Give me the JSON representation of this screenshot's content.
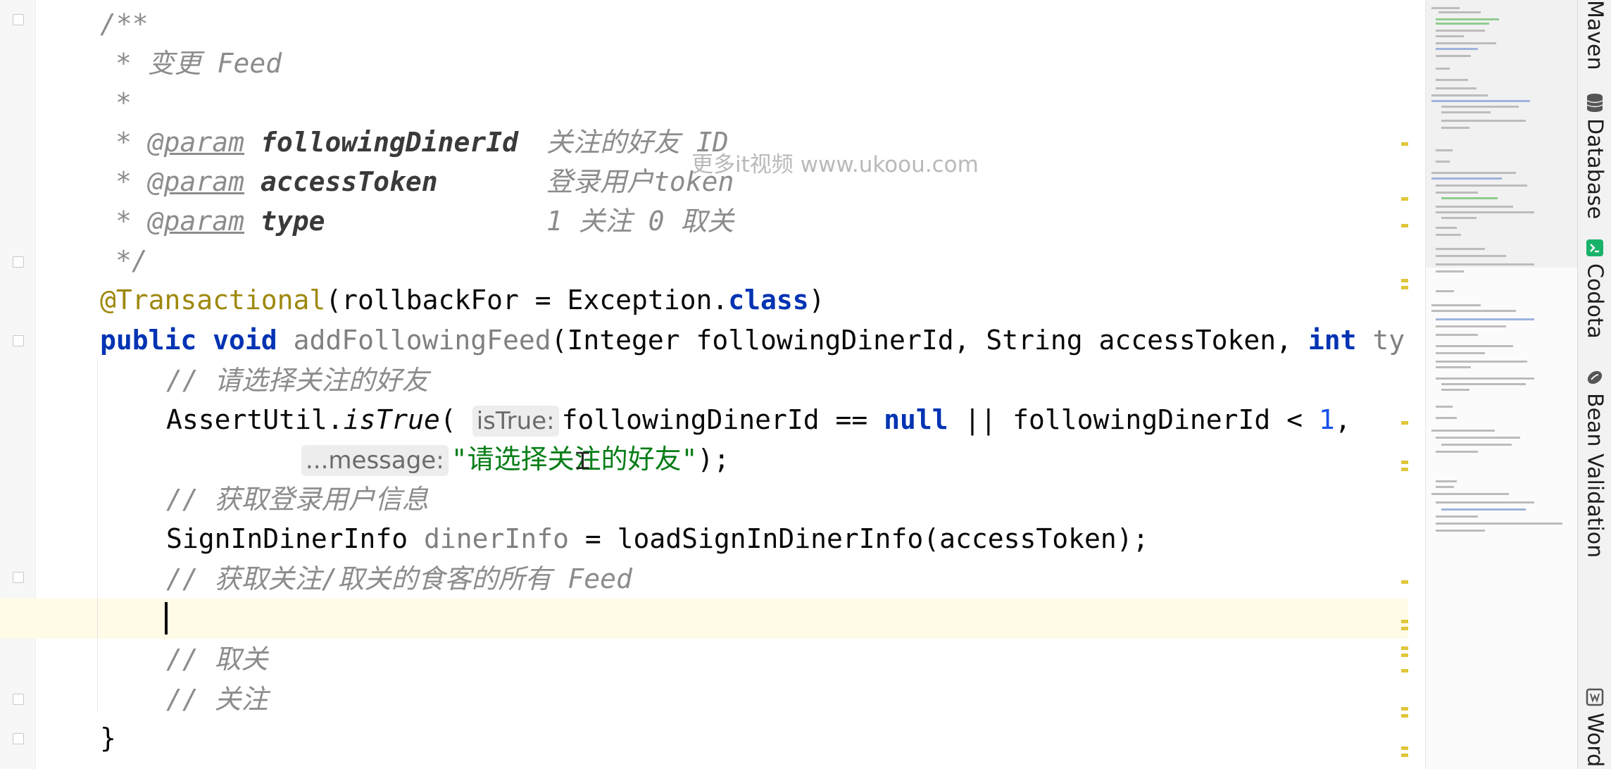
{
  "editor": {
    "watermark": "更多it视频 www.ukoou.com",
    "javadoc": {
      "open": "/**",
      "summary": "* 变更 Feed",
      "blank": "*",
      "param_tag": "@param",
      "params": [
        {
          "name": "followingDinerId",
          "desc": "关注的好友 ID"
        },
        {
          "name": "accessToken",
          "desc": "登录用户token"
        },
        {
          "name": "type",
          "desc": "1 关注 0 取关"
        }
      ],
      "close": "*/"
    },
    "annotation": {
      "name": "@Transactional",
      "args": "(rollbackFor = Exception.",
      "kw": "class",
      "end": ")"
    },
    "signature": {
      "kw1": "public",
      "kw2": "void",
      "method": "addFollowingFeed",
      "params": "(Integer followingDinerId, String accessToken, ",
      "kw3": "int",
      "tail": "ty"
    },
    "comment_select_friend": "// 请选择关注的好友",
    "assert_line": {
      "call": "AssertUtil.",
      "method": "isTrue",
      "open": "(",
      "hint": "isTrue:",
      "cond_a": "followingDinerId == ",
      "null_kw": "null",
      "cond_b": " || followingDinerId < ",
      "num": "1",
      "comma": ","
    },
    "assert_cont": {
      "hint": "...message:",
      "str": "\"请选择关注的好友\"",
      "end": ");"
    },
    "comment_get_user": "// 获取登录用户信息",
    "signin_line": {
      "type": "SignInDinerInfo ",
      "var": "dinerInfo",
      "rest": " = loadSignInDinerInfo(accessToken);"
    },
    "comment_get_feeds": "// 获取关注/取关的食客的所有 Feed",
    "comment_unfollow": "// 取关",
    "comment_follow": "// 关注",
    "closing_brace": "}"
  },
  "tool_windows": [
    {
      "label": "Maven",
      "icon": "maven-icon"
    },
    {
      "label": "Database",
      "icon": "database-icon"
    },
    {
      "label": "Codota",
      "icon": "codota-icon"
    },
    {
      "label": "Bean Validation",
      "icon": "bean-validation-icon"
    },
    {
      "label": "Word",
      "icon": "word-icon"
    }
  ],
  "colors": {
    "keyword": "#0033b3",
    "string": "#067d17",
    "number": "#1750eb",
    "comment": "#8c8c8c",
    "annotation": "#9e880d",
    "marker": "#e0c63a"
  }
}
